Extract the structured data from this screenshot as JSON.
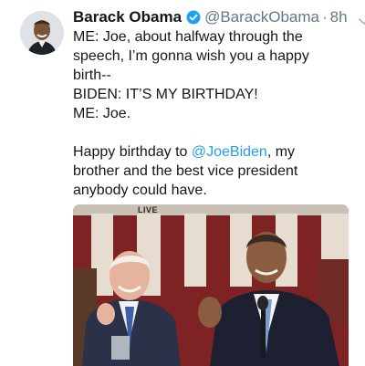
{
  "tweet": {
    "author": {
      "display_name": "Barack Obama",
      "handle": "@BarackObama",
      "verified_icon": "verified-badge-icon"
    },
    "separator": "·",
    "timestamp": "8h",
    "menu_icon": "chevron-down-icon",
    "lines": [
      "ME: Joe, about halfway through the",
      "speech, I’m gonna wish you a happy",
      "birth--",
      "BIDEN: IT’S MY BIRTHDAY!",
      "ME: Joe."
    ],
    "closing": {
      "prefix": "Happy birthday to ",
      "mention": "@JoeBiden",
      "suffix": ", my",
      "line2": "brother and the best vice president",
      "line3": "anybody could have."
    },
    "media": {
      "live_label": "LIVE"
    }
  },
  "colors": {
    "text": "#14171a",
    "secondary": "#657786",
    "link": "#1da1f2",
    "verified": "#1da1f2"
  }
}
